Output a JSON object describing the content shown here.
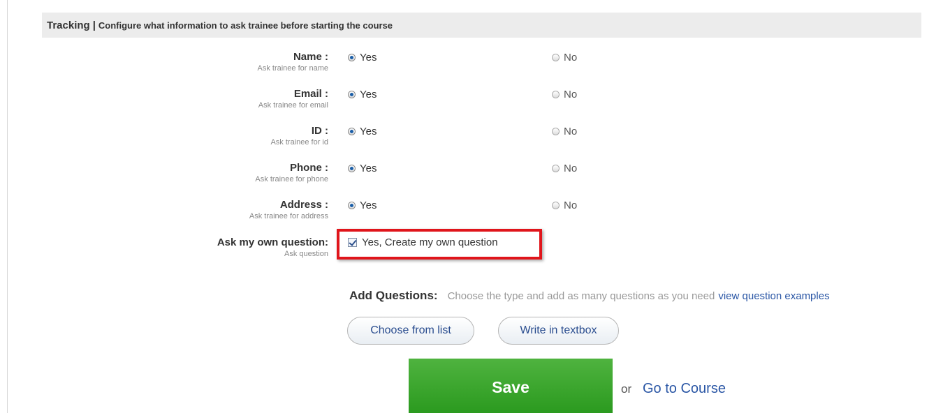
{
  "section": {
    "title": "Tracking",
    "separator": "|",
    "description": "Configure what information to ask trainee before starting the course"
  },
  "fields": [
    {
      "label": "Name :",
      "hint": "Ask trainee for name",
      "yes": "Yes",
      "no": "No",
      "selected": "yes"
    },
    {
      "label": "Email :",
      "hint": "Ask trainee for email",
      "yes": "Yes",
      "no": "No",
      "selected": "yes"
    },
    {
      "label": "ID :",
      "hint": "Ask trainee for id",
      "yes": "Yes",
      "no": "No",
      "selected": "yes"
    },
    {
      "label": "Phone :",
      "hint": "Ask trainee for phone",
      "yes": "Yes",
      "no": "No",
      "selected": "yes"
    },
    {
      "label": "Address :",
      "hint": "Ask trainee for address",
      "yes": "Yes",
      "no": "No",
      "selected": "yes"
    }
  ],
  "own_question": {
    "label": "Ask my own question:",
    "hint": "Ask question",
    "checkbox_label": "Yes, Create my own question",
    "checked": true
  },
  "add_questions": {
    "label": "Add Questions:",
    "help": "Choose the type and add as many questions as you need",
    "link": "view question examples",
    "choose_button": "Choose from list",
    "write_button": "Write in textbox"
  },
  "footer": {
    "save": "Save",
    "or": "or",
    "go_to_course": "Go to Course"
  },
  "colors": {
    "highlight": "#e0151b",
    "save_green": "#3aa62c",
    "link": "#2a56a5",
    "header_bg": "#ececec"
  }
}
